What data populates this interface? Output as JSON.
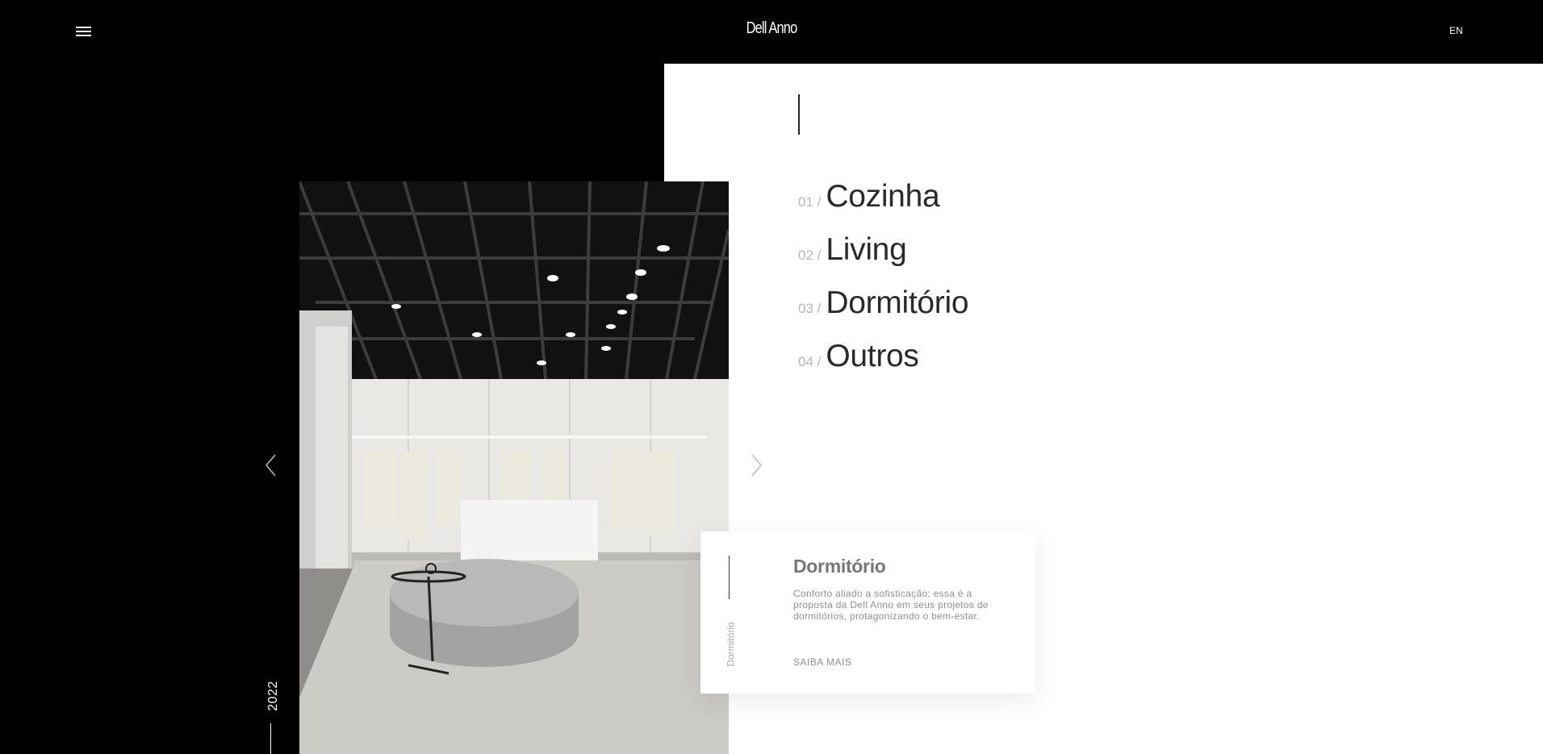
{
  "header": {
    "logo": "Dell Anno",
    "language": "EN"
  },
  "nav": [
    {
      "number": "01 /",
      "label": "Cozinha"
    },
    {
      "number": "02 /",
      "label": "Living"
    },
    {
      "number": "03 /",
      "label": "Dormitório"
    },
    {
      "number": "04 /",
      "label": "Outros"
    }
  ],
  "slider": {
    "year": "2022"
  },
  "card": {
    "vertical_label": "Dormitório",
    "title": "Dormitório",
    "description": "Conforto aliado a sofisticação: essa é a proposta da Dell Anno em seus projetos de dormitórios, protagonizando o bem-estar.",
    "link": "SAIBA MAIS"
  },
  "colors": {
    "background": "#000000",
    "panel": "#ffffff",
    "nav_number": "#b6b6b6",
    "nav_label": "#2a2a2a",
    "card_text": "#8f8f8f"
  },
  "icons": [
    "menu-icon",
    "chevron-left-icon",
    "chevron-right-icon"
  ]
}
